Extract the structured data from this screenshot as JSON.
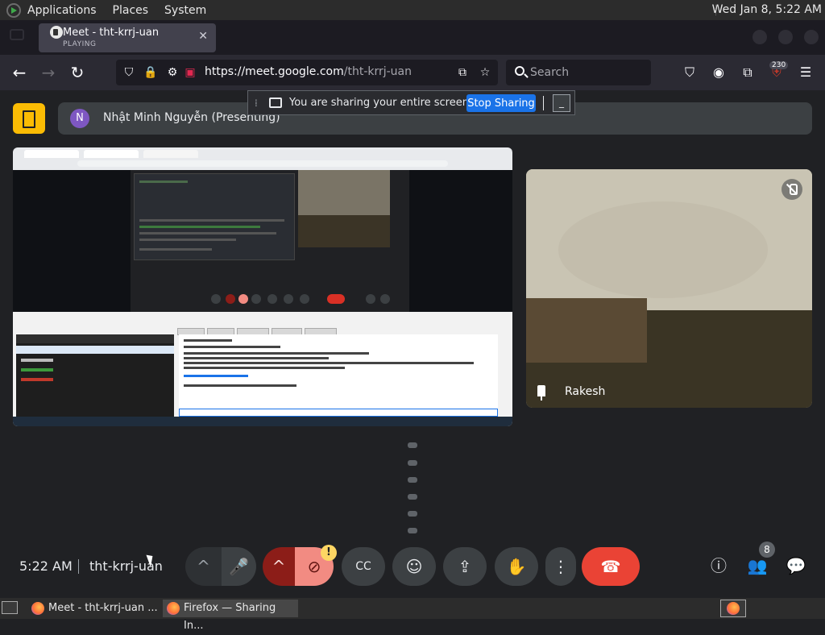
{
  "panel": {
    "menu": [
      "Applications",
      "Places",
      "System"
    ],
    "clock": "Wed Jan  8,  5:22 AM"
  },
  "browser": {
    "tab": {
      "title": "Meet - tht-krrj-uan",
      "subtitle": "PLAYING"
    },
    "url_host": "https://meet.google.com",
    "url_path": "/tht-krrj-uan",
    "search_placeholder": "Search",
    "extension_badge": "230"
  },
  "share_banner": {
    "text": "You are sharing your entire screen.",
    "stop_label": "Stop Sharing",
    "minimize_glyph": "_"
  },
  "presenter": {
    "initial": "N",
    "name": "Nhật Minh Nguyễn (Presenting)"
  },
  "participant": {
    "name": "Rakesh"
  },
  "meeting": {
    "time": "5:22 AM",
    "code": "tht-krrj-uan",
    "participant_count": "8"
  },
  "controls": {
    "chevron_glyph": "^",
    "mic_glyph": "🎤",
    "warning_glyph": "!",
    "more_glyph": "⋮"
  },
  "taskbar": {
    "items": [
      "Meet - tht-krrj-uan ...",
      "Firefox — Sharing In..."
    ]
  },
  "colors": {
    "meet_bg": "#202124",
    "stop_button": "#1a73e8",
    "end_call": "#ea4335",
    "camera_off": "#f28b82",
    "meet_logo": "#fbbc04"
  }
}
